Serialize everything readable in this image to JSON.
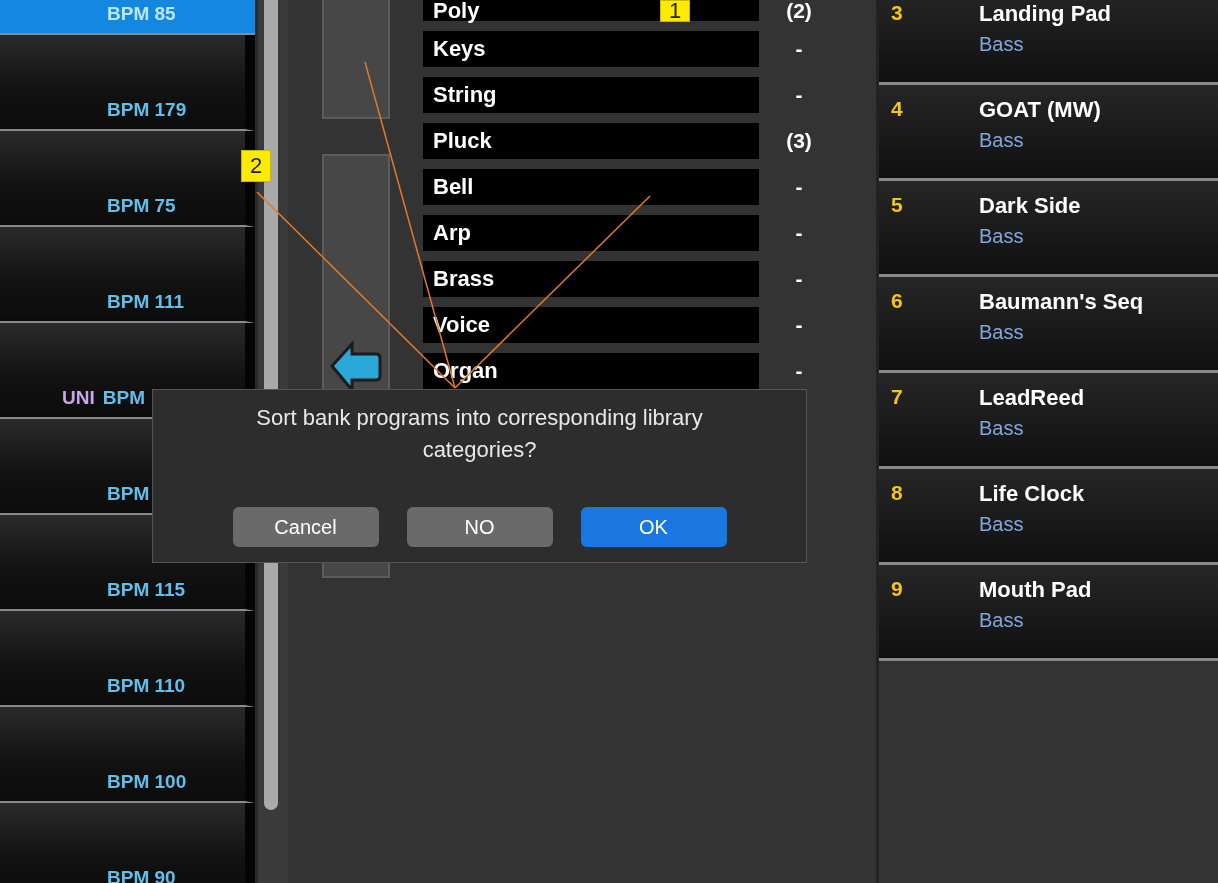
{
  "programs": [
    {
      "bpm": "BPM 85",
      "selected": true
    },
    {
      "bpm": "BPM 179",
      "selected": false
    },
    {
      "bpm": "BPM 75",
      "selected": false
    },
    {
      "bpm": "BPM 111",
      "selected": false
    },
    {
      "tag": "UNI",
      "bpm": "BPM",
      "selected": false
    },
    {
      "bpm": "BPM",
      "selected": false
    },
    {
      "bpm": "BPM 115",
      "selected": false
    },
    {
      "bpm": "BPM 110",
      "selected": false
    },
    {
      "bpm": "BPM 100",
      "selected": false
    },
    {
      "bpm": "BPM 90",
      "selected": false
    }
  ],
  "categories": [
    {
      "name": "Poly",
      "count": "(2)"
    },
    {
      "name": "Keys",
      "count": "-"
    },
    {
      "name": "String",
      "count": "-"
    },
    {
      "name": "Pluck",
      "count": "(3)"
    },
    {
      "name": "Bell",
      "count": "-"
    },
    {
      "name": "Arp",
      "count": "-"
    },
    {
      "name": "Brass",
      "count": "-"
    },
    {
      "name": "Voice",
      "count": "-"
    },
    {
      "name": "Organ",
      "count": "-"
    }
  ],
  "bank": [
    {
      "number": "3",
      "name": "Landing Pad",
      "category": "Bass"
    },
    {
      "number": "4",
      "name": "GOAT (MW)",
      "category": "Bass"
    },
    {
      "number": "5",
      "name": "Dark Side",
      "category": "Bass"
    },
    {
      "number": "6",
      "name": "Baumann's Seq",
      "category": "Bass"
    },
    {
      "number": "7",
      "name": "LeadReed",
      "category": "Bass"
    },
    {
      "number": "8",
      "name": "Life Clock",
      "category": "Bass"
    },
    {
      "number": "9",
      "name": "Mouth Pad",
      "category": "Bass"
    }
  ],
  "annotations": [
    {
      "label": "1"
    },
    {
      "label": "2"
    }
  ],
  "dialog": {
    "message": "Sort bank programs into corresponding library categories?",
    "buttons": [
      {
        "label": "Cancel",
        "default": false
      },
      {
        "label": "NO",
        "default": false
      },
      {
        "label": "OK",
        "default": true
      }
    ]
  }
}
